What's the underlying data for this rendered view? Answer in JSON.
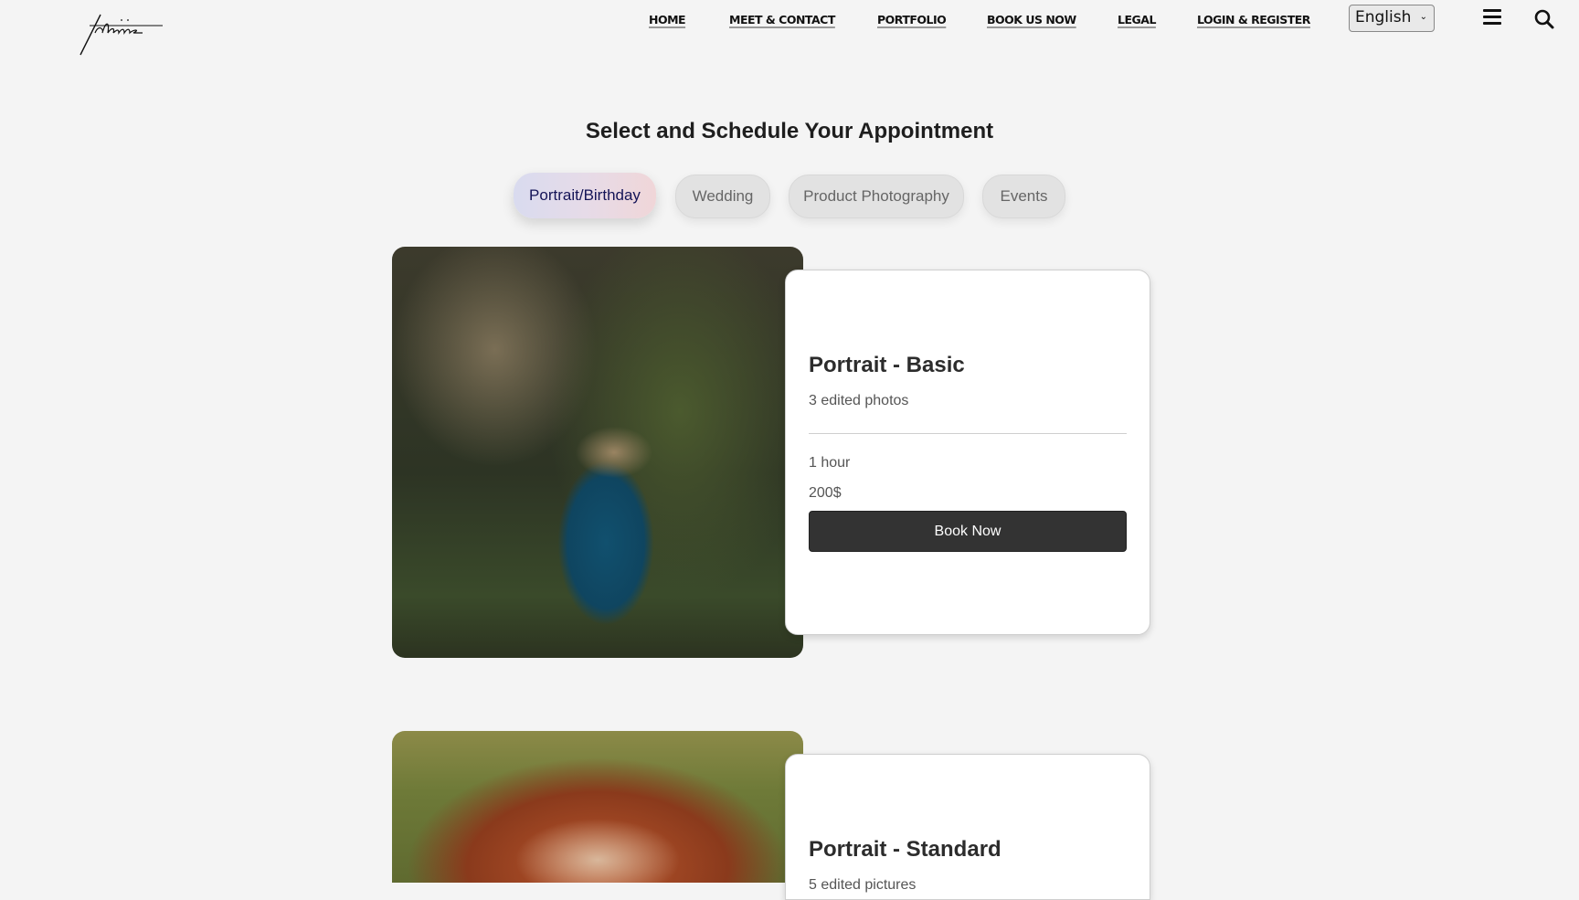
{
  "header": {
    "logo_text": "tchiiz",
    "nav": [
      {
        "label": "HOME"
      },
      {
        "label": "MEET & CONTACT"
      },
      {
        "label": "PORTFOLIO"
      },
      {
        "label": "BOOK US NOW"
      },
      {
        "label": "LEGAL"
      },
      {
        "label": "LOGIN & REGISTER"
      }
    ],
    "language": {
      "selected": "English"
    },
    "icons": {
      "menu": "hamburger-menu-icon",
      "search": "search-icon"
    }
  },
  "main": {
    "title": "Select and Schedule Your Appointment",
    "tabs": [
      {
        "label": "Portrait/Birthday",
        "active": true
      },
      {
        "label": "Wedding",
        "active": false
      },
      {
        "label": "Product Photography",
        "active": false
      },
      {
        "label": "Events",
        "active": false
      }
    ],
    "packages": [
      {
        "name": "Portrait - Basic",
        "description": "3 edited photos",
        "duration": "1 hour",
        "price": "200$",
        "button": "Book Now",
        "image": "woman in blue dress and sun hat in forest"
      },
      {
        "name": "Portrait - Standard",
        "description": "5 edited pictures",
        "image": "woman with red hair, hands on head"
      }
    ]
  },
  "colors": {
    "background": "#f4f4f4",
    "active_tab_text": "#141457",
    "button_bg": "#333333"
  }
}
